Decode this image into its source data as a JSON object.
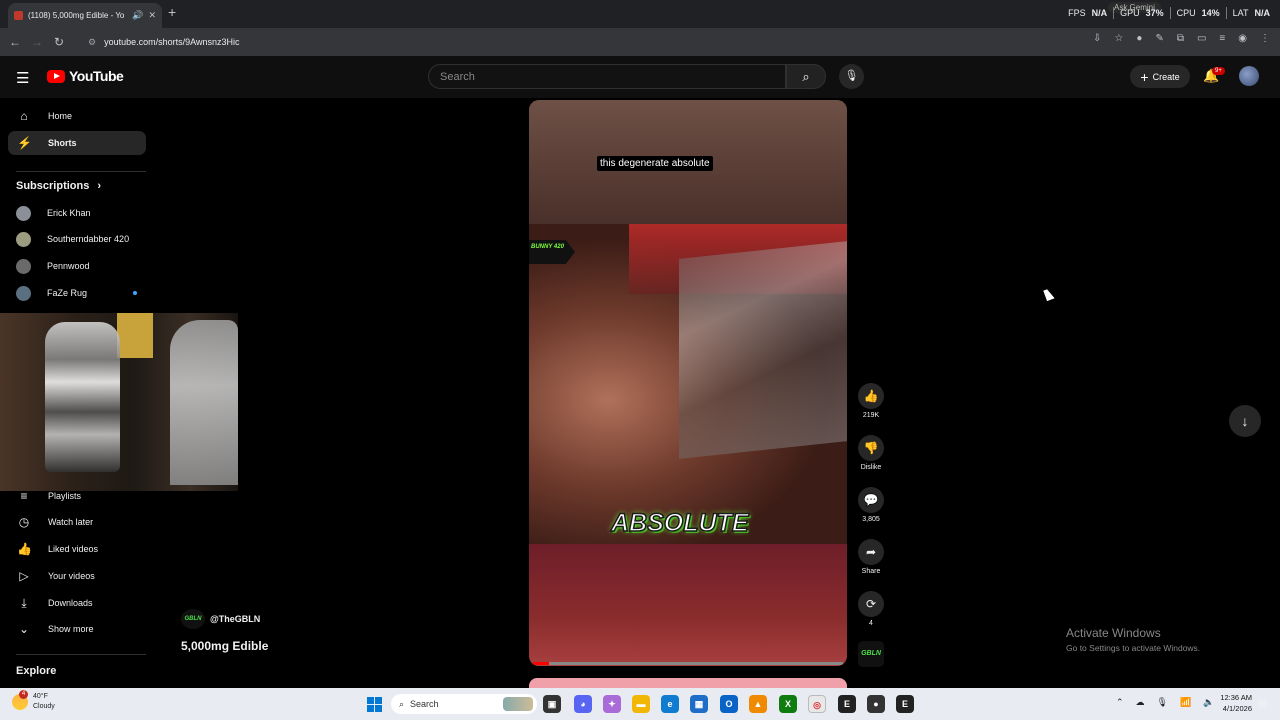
{
  "browser": {
    "tab_title": "(1108) 5,000mg Edible - Yo",
    "new_tab_icon": "plus-icon",
    "url": "youtube.com/shorts/9Awnsnz3Hic",
    "gemini_label": "Ask Gemini",
    "perf": {
      "fps_label": "FPS",
      "fps_value": "N/A",
      "gpu_label": "GPU",
      "gpu_value": "37%",
      "cpu_label": "CPU",
      "cpu_value": "14%",
      "lat_label": "LAT",
      "lat_value": "N/A"
    }
  },
  "header": {
    "logo_text": "YouTube",
    "search_placeholder": "Search",
    "create_label": "Create",
    "notif_badge": "9+"
  },
  "sidebar": {
    "top": [
      {
        "label": "Home",
        "icon": "home-icon"
      },
      {
        "label": "Shorts",
        "icon": "shorts-icon"
      }
    ],
    "subscriptions_title": "Subscriptions",
    "subscriptions": [
      {
        "label": "Erick Khan",
        "color": "#8a8f98"
      },
      {
        "label": "Southerndabber 420",
        "color": "#9c9c80"
      },
      {
        "label": "Pennwood",
        "color": "#6a6a6a"
      },
      {
        "label": "FaZe Rug",
        "color": "#5a7080",
        "live_dot": true
      }
    ],
    "you": [
      {
        "label": "Playlists",
        "icon": "playlist-icon"
      },
      {
        "label": "Watch later",
        "icon": "clock-icon"
      },
      {
        "label": "Liked videos",
        "icon": "thumbs-up-icon"
      },
      {
        "label": "Your videos",
        "icon": "play-icon"
      },
      {
        "label": "Downloads",
        "icon": "download-icon"
      },
      {
        "label": "Show more",
        "icon": "chevron-down-icon"
      }
    ],
    "explore_title": "Explore"
  },
  "short": {
    "caption": "this degenerate absolute",
    "overlay_tag": "BUNNY 420",
    "big_word": "ABSOLUTE",
    "channel_handle": "@TheGBLN",
    "title": "5,000mg Edible",
    "progress_percent": 5
  },
  "actions": {
    "like_count": "219K",
    "dislike_label": "Dislike",
    "comment_count": "3,805",
    "share_label": "Share",
    "remix_count": "4"
  },
  "activate": {
    "line1": "Activate Windows",
    "line2": "Go to Settings to activate Windows."
  },
  "taskbar": {
    "weather_temp": "40°F",
    "weather_desc": "Cloudy",
    "weather_badge": "4",
    "search_label": "Search",
    "time": "12:36 AM",
    "date": "4/1/2026"
  }
}
